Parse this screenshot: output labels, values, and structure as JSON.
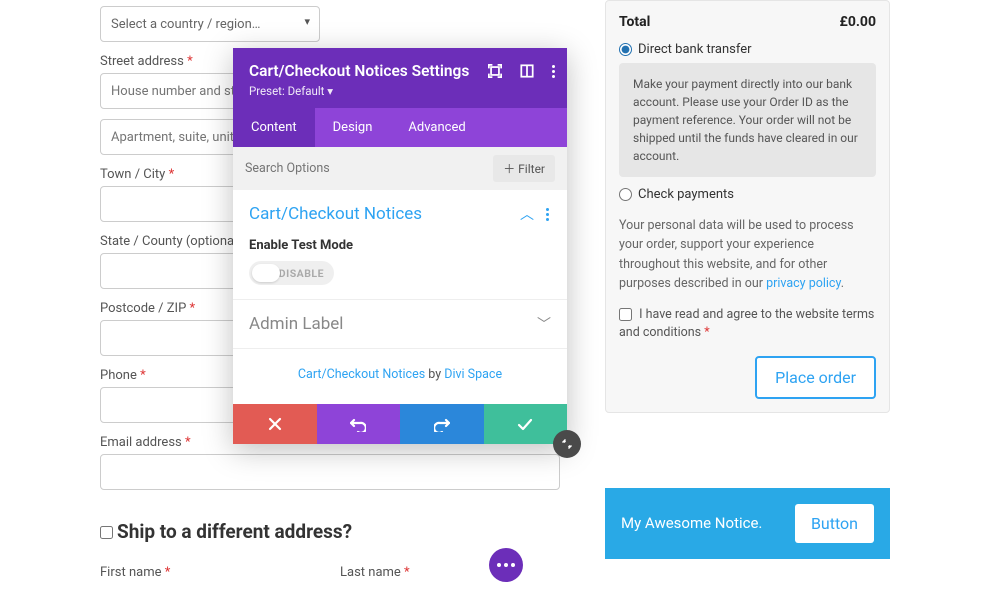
{
  "form": {
    "country_placeholder": "Select a country / region…",
    "street_label": "Street address",
    "street1_placeholder": "House number and street name",
    "street2_placeholder": "Apartment, suite, unit, etc.",
    "town_label": "Town / City",
    "county_label": "State / County (optional)",
    "postcode_label": "Postcode / ZIP",
    "phone_label": "Phone",
    "email_label": "Email address",
    "ship_heading": "Ship to a different address?",
    "first_name_label": "First name",
    "last_name_label": "Last name",
    "required_marker": "*"
  },
  "order": {
    "total_label": "Total",
    "total_value": "£0.00",
    "bank_label": "Direct bank transfer",
    "bank_desc": "Make your payment directly into our bank account. Please use your Order ID as the payment reference. Your order will not be shipped until the funds have cleared in our account.",
    "check_label": "Check payments",
    "privacy_text_pre": "Your personal data will be used to process your order, support your experience throughout this website, and for other purposes described in our ",
    "privacy_link": "privacy policy",
    "terms_text": "I have read and agree to the website terms and conditions",
    "place_order": "Place order"
  },
  "notice": {
    "text": "My Awesome Notice.",
    "button": "Button"
  },
  "modal": {
    "title": "Cart/Checkout Notices Settings",
    "preset": "Preset: Default ▾",
    "tabs": {
      "content": "Content",
      "design": "Design",
      "advanced": "Advanced"
    },
    "search_placeholder": "Search Options",
    "filter_label": "Filter",
    "section1_title": "Cart/Checkout Notices",
    "enable_label": "Enable Test Mode",
    "toggle_state": "DISABLE",
    "section2_title": "Admin Label",
    "credits_link1": "Cart/Checkout Notices",
    "credits_by": " by ",
    "credits_link2": "Divi Space"
  }
}
